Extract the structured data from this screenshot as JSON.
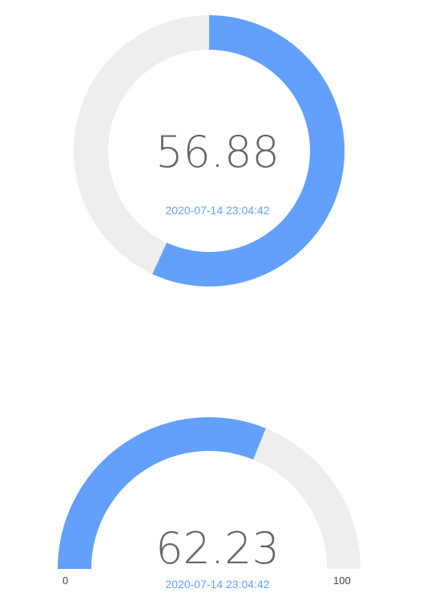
{
  "colors": {
    "accent": "#62a0fb",
    "track": "#eeeeee",
    "value_text": "#666666",
    "timestamp_text": "#62a0fb"
  },
  "gauge_ring": {
    "value": "56.88",
    "percent": 56.88,
    "timestamp": "2020-07-14 23:04:42"
  },
  "gauge_half": {
    "value": "62.23",
    "percent": 62.23,
    "timestamp": "2020-07-14 23:04:42",
    "min_label": "0",
    "max_label": "100"
  }
}
